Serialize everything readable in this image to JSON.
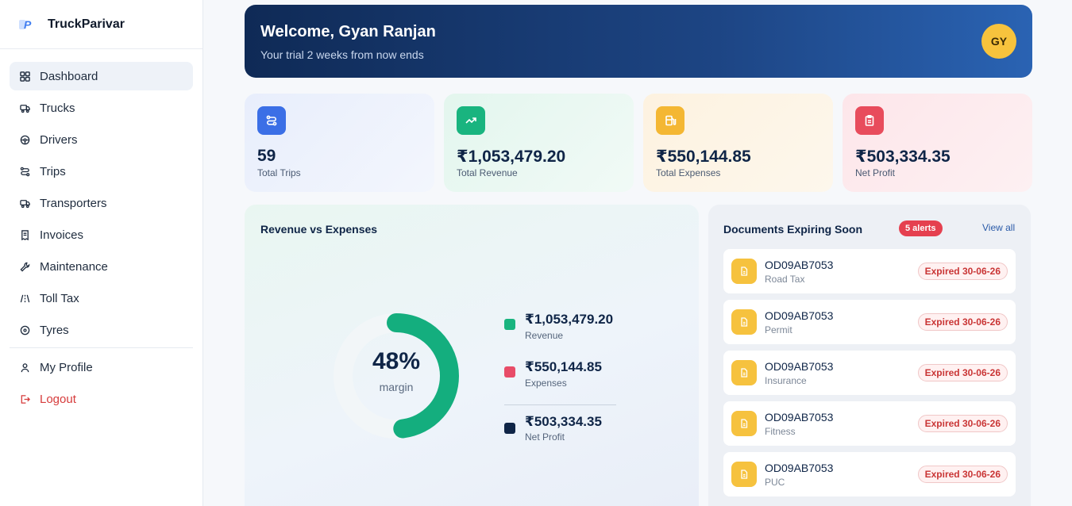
{
  "app": {
    "name": "TruckParivar"
  },
  "sidebar": {
    "items": [
      {
        "label": "Dashboard",
        "icon": "grid-icon",
        "active": true
      },
      {
        "label": "Trucks",
        "icon": "truck-icon"
      },
      {
        "label": "Drivers",
        "icon": "steering-wheel-icon"
      },
      {
        "label": "Trips",
        "icon": "route-icon"
      },
      {
        "label": "Transporters",
        "icon": "truck-icon"
      },
      {
        "label": "Invoices",
        "icon": "receipt-icon"
      },
      {
        "label": "Maintenance",
        "icon": "wrench-icon"
      },
      {
        "label": "Toll Tax",
        "icon": "road-icon"
      },
      {
        "label": "Tyres",
        "icon": "tyre-icon"
      }
    ],
    "profile_label": "My Profile",
    "logout_label": "Logout"
  },
  "banner": {
    "title": "Welcome, Gyan Ranjan",
    "subtitle": "Your trial 2 weeks from now ends",
    "avatar_initials": "GY"
  },
  "stats": [
    {
      "value": "59",
      "label": "Total Trips",
      "icon": "route-icon",
      "accent": "#3b6fe6"
    },
    {
      "value": "₹1,053,479.20",
      "label": "Total Revenue",
      "icon": "trending-up-icon",
      "accent": "#19b47f"
    },
    {
      "value": "₹550,144.85",
      "label": "Total Expenses",
      "icon": "fuel-icon",
      "accent": "#f4b733"
    },
    {
      "value": "₹503,334.35",
      "label": "Net Profit",
      "icon": "clipboard-icon",
      "accent": "#e84c5c"
    }
  ],
  "revenue_card": {
    "title": "Revenue vs Expenses",
    "margin_value": "48%",
    "margin_label": "margin",
    "margin_fraction": 0.48,
    "legend": [
      {
        "value": "₹1,053,479.20",
        "label": "Revenue",
        "color": "#19b47f"
      },
      {
        "value": "₹550,144.85",
        "label": "Expenses",
        "color": "#e84c68"
      },
      {
        "value": "₹503,334.35",
        "label": "Net Profit",
        "color": "#0f2547"
      }
    ]
  },
  "documents": {
    "title": "Documents Expiring Soon",
    "alerts_badge": "5 alerts",
    "view_all": "View all",
    "items": [
      {
        "vehicle": "OD09AB7053",
        "type": "Road Tax",
        "status": "Expired 30-06-26"
      },
      {
        "vehicle": "OD09AB7053",
        "type": "Permit",
        "status": "Expired 30-06-26"
      },
      {
        "vehicle": "OD09AB7053",
        "type": "Insurance",
        "status": "Expired 30-06-26"
      },
      {
        "vehicle": "OD09AB7053",
        "type": "Fitness",
        "status": "Expired 30-06-26"
      },
      {
        "vehicle": "OD09AB7053",
        "type": "PUC",
        "status": "Expired 30-06-26"
      }
    ]
  }
}
